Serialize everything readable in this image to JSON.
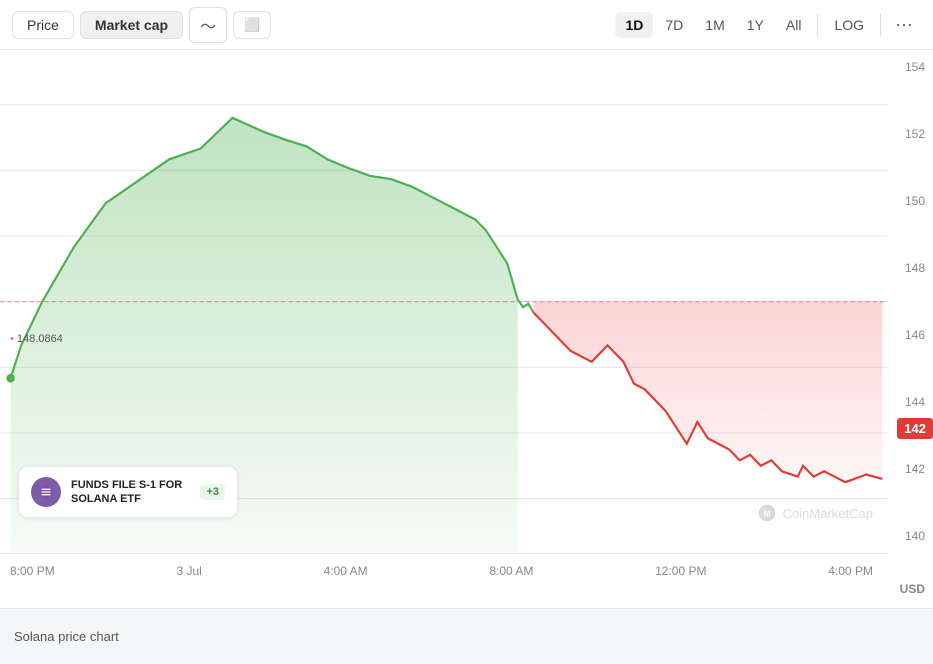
{
  "toolbar": {
    "tabs": [
      {
        "label": "Price",
        "active": false
      },
      {
        "label": "Market cap",
        "active": false
      }
    ],
    "chart_type_line": "〜",
    "chart_type_candle": "⬜",
    "time_ranges": [
      {
        "label": "1D",
        "active": true
      },
      {
        "label": "7D",
        "active": false
      },
      {
        "label": "1M",
        "active": false
      },
      {
        "label": "1Y",
        "active": false
      },
      {
        "label": "All",
        "active": false
      }
    ],
    "log_label": "LOG",
    "more_label": "···"
  },
  "chart": {
    "y_labels": [
      "154",
      "152",
      "150",
      "148",
      "146",
      "144",
      "142",
      "140"
    ],
    "x_labels": [
      "8:00 PM",
      "3 Jul",
      "4:00 AM",
      "8:00 AM",
      "12:00 PM",
      "4:00 PM"
    ],
    "ref_price": "148.0864",
    "current_price": "142",
    "currency": "USD"
  },
  "news_card": {
    "text": "FUNDS FILE S-1 FOR SOLANA ETF",
    "badge": "+3"
  },
  "watermark": "CoinMarketCap",
  "caption": "Solana price chart"
}
